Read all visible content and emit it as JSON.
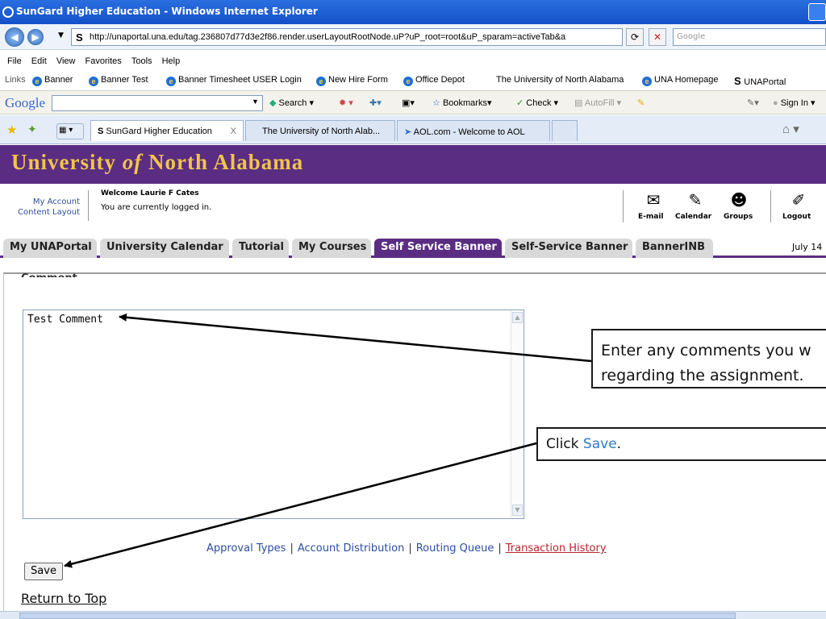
{
  "window": {
    "title": "SunGard Higher Education - Windows Internet Explorer"
  },
  "address": {
    "url": "http://unaportal.una.edu/tag.236807d77d3e2f86.render.userLayoutRootNode.uP?uP_root=root&uP_sparam=activeTab&a",
    "search_placeholder": "Google"
  },
  "menu": [
    "File",
    "Edit",
    "View",
    "Favorites",
    "Tools",
    "Help"
  ],
  "links_bar": {
    "label": "Links",
    "items": [
      "Banner",
      "Banner Test",
      "Banner Timesheet USER Login",
      "New Hire Form",
      "Office Depot",
      "The University of North Alabama",
      "UNA Homepage",
      "UNAPortal"
    ]
  },
  "google_toolbar": {
    "logo": "Google",
    "search": "Search",
    "bookmarks": "Bookmarks",
    "check": "Check",
    "autofill": "AutoFill",
    "sign_in": "Sign In"
  },
  "browser_tabs": [
    {
      "label": "SunGard Higher Education",
      "close": "X"
    },
    {
      "label": "The University of North Alab..."
    },
    {
      "label": "AOL.com - Welcome to AOL"
    }
  ],
  "portal": {
    "name_a": "University ",
    "name_b": "of",
    "name_c": " North Alabama",
    "my_account": "My Account",
    "content_layout": "Content Layout",
    "welcome": "Welcome Laurie F Cates",
    "logged_in": "You are currently logged in.",
    "quick_links": [
      "E-mail",
      "Calendar",
      "Groups",
      "Logout"
    ],
    "tabs": [
      "My UNAPortal",
      "University Calendar",
      "Tutorial",
      "My Courses",
      "Self Service Banner",
      "Self-Service Banner",
      "BannerINB"
    ],
    "active_tab": "Self Service Banner",
    "date": "July 14"
  },
  "form": {
    "heading": "Comment",
    "comment_value": "Test Comment",
    "links": [
      "Approval Types",
      "Account Distribution",
      "Routing Queue"
    ],
    "history_link": "Transaction History",
    "separator": "|",
    "save": "Save",
    "return_top": "Return to Top"
  },
  "callouts": {
    "one_line1": "Enter any comments you w",
    "one_line2": "regarding the assignment.",
    "two_prefix": "Click ",
    "two_highlight": "Save",
    "two_suffix": "."
  },
  "colors": {
    "portal_purple": "#5a2d82",
    "portal_gold": "#f1c44a",
    "link_blue": "#2c4da0",
    "history_red": "#b8252b",
    "callout_highlight": "#2c7bc7"
  }
}
